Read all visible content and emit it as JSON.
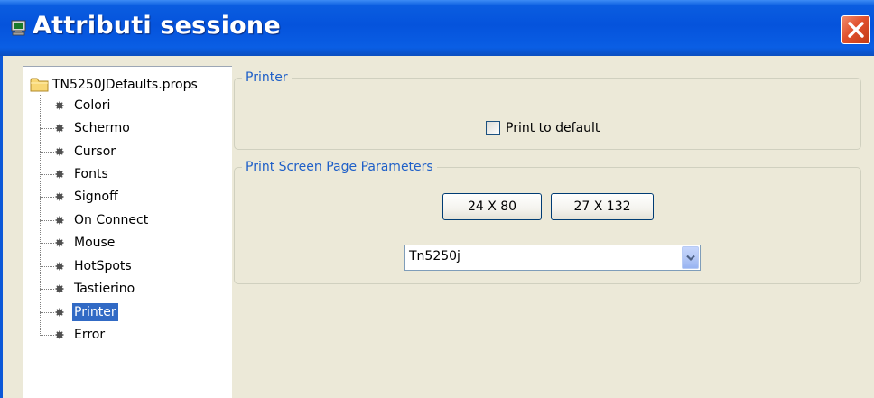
{
  "window": {
    "title": "Attributi sessione",
    "icon": "terminal-icon",
    "close_icon": "close-icon"
  },
  "tree": {
    "root_label": "TN5250JDefaults.props",
    "root_icon": "folder-icon",
    "items": [
      {
        "label": "Colori",
        "selected": false
      },
      {
        "label": "Schermo",
        "selected": false
      },
      {
        "label": "Cursor",
        "selected": false
      },
      {
        "label": "Fonts",
        "selected": false
      },
      {
        "label": "Signoff",
        "selected": false
      },
      {
        "label": "On Connect",
        "selected": false
      },
      {
        "label": "Mouse",
        "selected": false
      },
      {
        "label": "HotSpots",
        "selected": false
      },
      {
        "label": "Tastierino",
        "selected": false
      },
      {
        "label": "Printer",
        "selected": true
      },
      {
        "label": "Error",
        "selected": false
      }
    ]
  },
  "printer_group": {
    "title": "Printer",
    "print_to_default_label": "Print to default",
    "print_to_default_checked": false
  },
  "print_screen_group": {
    "title": "Print Screen Page Parameters",
    "button_24x80": "24 X 80",
    "button_27x132": "27 X 132",
    "printer_select_value": "Tn5250j"
  },
  "colors": {
    "title_bar": "#0553dc",
    "accent_blue": "#1e5fc8",
    "selection": "#316ac5",
    "close_red": "#e0502c",
    "window_bg": "#ece9d8"
  }
}
